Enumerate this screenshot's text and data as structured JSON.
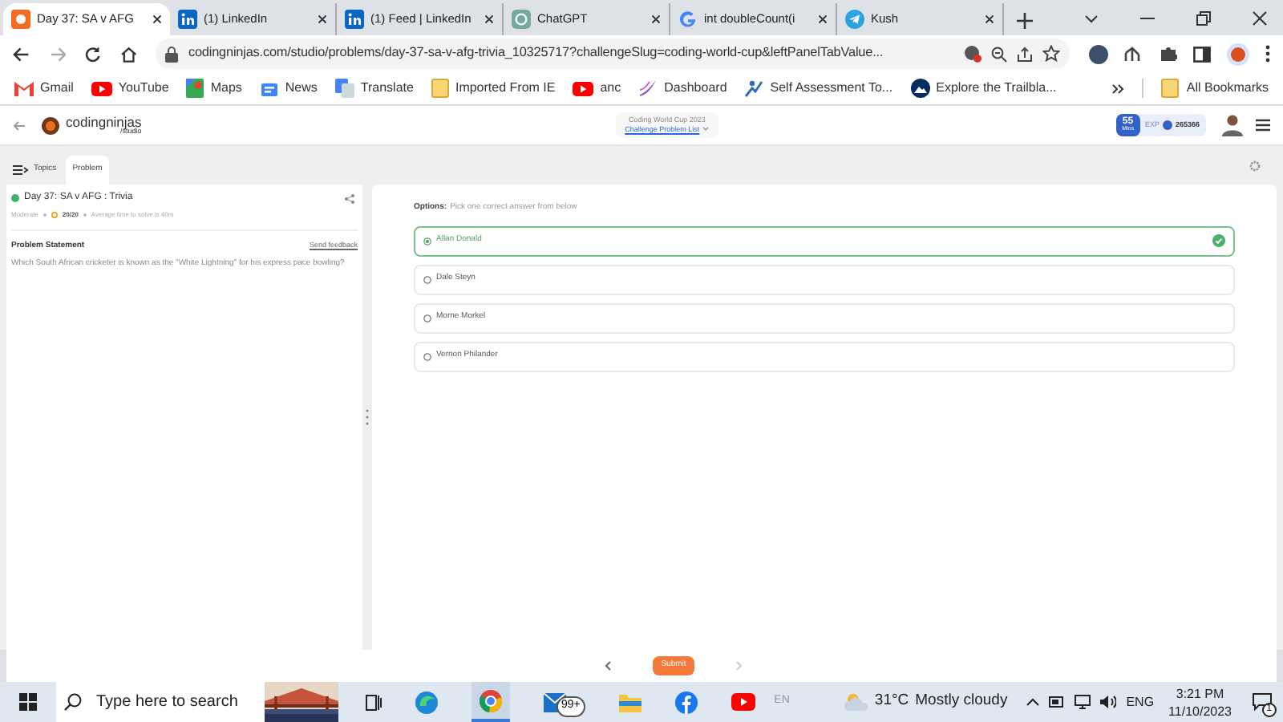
{
  "browser": {
    "tabs": [
      {
        "title": "Day 37: SA v AFG",
        "selected": true
      },
      {
        "title": "(1) LinkedIn",
        "selected": false
      },
      {
        "title": "(1) Feed | LinkedIn",
        "selected": false
      },
      {
        "title": "ChatGPT",
        "selected": false
      },
      {
        "title": "int doubleCount(i",
        "selected": false
      },
      {
        "title": "Kush",
        "selected": false
      }
    ],
    "url": "codingninjas.com/studio/problems/day-37-sa-v-afg-trivia_10325717?challengeSlug=coding-world-cup&leftPanelTabValue...",
    "bookmarks": [
      {
        "label": "Gmail"
      },
      {
        "label": "YouTube"
      },
      {
        "label": "Maps"
      },
      {
        "label": "News"
      },
      {
        "label": "Translate"
      },
      {
        "label": "Imported From IE"
      },
      {
        "label": "anc"
      },
      {
        "label": "Dashboard"
      },
      {
        "label": "Self Assessment To..."
      },
      {
        "label": "Explore the Trailbla..."
      }
    ],
    "all_bookmarks": "All Bookmarks"
  },
  "header": {
    "logo": "**coding**ninjas",
    "logo_sub": "/studio",
    "event": "Coding World Cup 2023",
    "event_link": "Challenge Problem List",
    "streak": "55",
    "streak_unit": "Mins",
    "exp_label": "EXP",
    "exp": "265366"
  },
  "panel_tabs": [
    {
      "label": "Topics",
      "selected": false
    },
    {
      "label": "Problem",
      "selected": true
    }
  ],
  "problem": {
    "title": "Day 37: SA v AFG : Trivia",
    "difficulty": "Moderate",
    "score": "20/20",
    "time": "Average time to solve is 40m",
    "section": "Problem Statement",
    "feedback": "Send feedback",
    "text": "Which South African cricketer is known as the \"White Lightning\" for his express pace bowling?"
  },
  "options_label": "Options:",
  "options_hint": "Pick one correct answer from below",
  "options": [
    {
      "label": "Allan Donald",
      "selected": true
    },
    {
      "label": "Dale Steyn",
      "selected": false
    },
    {
      "label": "Morne Morkel",
      "selected": false
    },
    {
      "label": "Vernon Philander",
      "selected": false
    }
  ],
  "submit": "Submit",
  "taskbar": {
    "search_placeholder": "Type here to search",
    "mail_badge": "99+",
    "input_hint": "EN",
    "temperature": "31°C",
    "weather": "Mostly cloudy",
    "language": "ENG",
    "time": "3:21 PM",
    "date": "11/10/2023",
    "notifications": "1"
  }
}
